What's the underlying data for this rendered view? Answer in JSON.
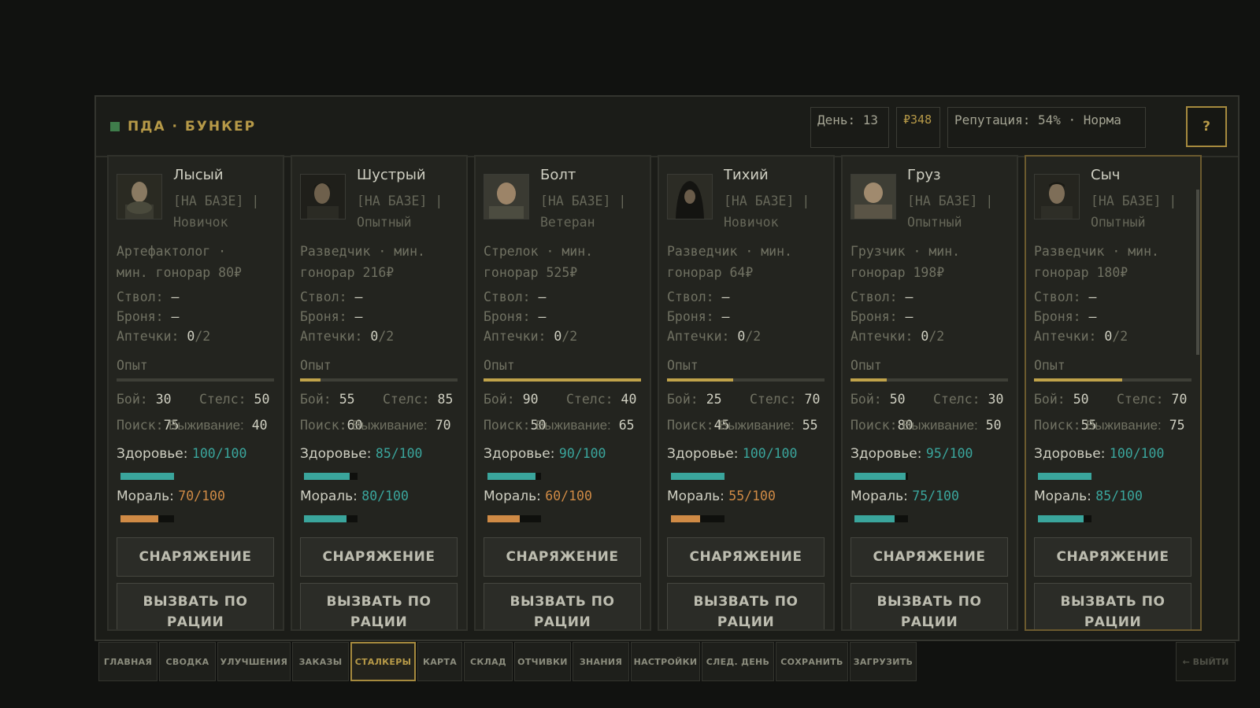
{
  "header": {
    "title": "ПДА · БУНКЕР",
    "day": "День: 13",
    "money": "₽348",
    "reputation": "Репутация: 54% · Норма",
    "help": "?"
  },
  "labels": {
    "barrel": "Ствол:",
    "armor": "Броня:",
    "medkits": "Аптечки:",
    "xp": "Опыт",
    "combat": "Бой:",
    "stealth": "Стелс:",
    "search": "Поиск:",
    "survival": "Выживание:",
    "health": "Здоровье:",
    "morale": "Мораль:",
    "equip_btn": "СНАРЯЖЕНИЕ",
    "radio_btn": "ВЫЗВАТЬ ПО РАЦИИ"
  },
  "colors": {
    "accent": "#b79a48",
    "health_bar": "#3aa59c",
    "morale_high": "#3aa59c",
    "morale_low": "#cf8a45"
  },
  "stalkers": [
    {
      "name": "Лысый",
      "status": "[НА БАЗЕ] |",
      "rank": "Новичок",
      "role1": "Артефактолог ·",
      "role2": "мин. гонорар 80₽",
      "barrel": "–",
      "armor": "–",
      "med_have": "0",
      "med_max": "/2",
      "xp": 0.0,
      "combat": "30",
      "stealth": "50",
      "search": "75",
      "survival": "40",
      "health": "100/100",
      "health_frac": 1.0,
      "morale": "70/100",
      "morale_frac": 0.7,
      "morale_color": "low",
      "highlight": false,
      "avatar": "bald-man"
    },
    {
      "name": "Шустрый",
      "status": "[НА БАЗЕ] |",
      "rank": "Опытный",
      "role1": "Разведчик · мин.",
      "role2": "гонорар 216₽",
      "barrel": "–",
      "armor": "–",
      "med_have": "0",
      "med_max": "/2",
      "xp": 0.13,
      "combat": "55",
      "stealth": "85",
      "search": "60",
      "survival": "70",
      "health": "85/100",
      "health_frac": 0.85,
      "morale": "80/100",
      "morale_frac": 0.8,
      "morale_color": "high",
      "highlight": false,
      "avatar": "dark-hair-man"
    },
    {
      "name": "Болт",
      "status": "[НА БАЗЕ] |",
      "rank": "Ветеран",
      "role1": "Стрелок · мин.",
      "role2": "гонорар 525₽",
      "barrel": "–",
      "armor": "–",
      "med_have": "0",
      "med_max": "/2",
      "xp": 1.0,
      "combat": "90",
      "stealth": "40",
      "search": "50",
      "survival": "65",
      "health": "90/100",
      "health_frac": 0.9,
      "morale": "60/100",
      "morale_frac": 0.6,
      "morale_color": "low",
      "highlight": false,
      "avatar": "veteran-man"
    },
    {
      "name": "Тихий",
      "status": "[НА БАЗЕ] |",
      "rank": "Новичок",
      "role1": "Разведчик · мин.",
      "role2": "гонорар 64₽",
      "barrel": "–",
      "armor": "–",
      "med_have": "0",
      "med_max": "/2",
      "xp": 0.42,
      "combat": "25",
      "stealth": "70",
      "search": "45",
      "survival": "55",
      "health": "100/100",
      "health_frac": 1.0,
      "morale": "55/100",
      "morale_frac": 0.55,
      "morale_color": "low",
      "highlight": false,
      "avatar": "hooded-figure"
    },
    {
      "name": "Груз",
      "status": "[НА БАЗЕ] |",
      "rank": "Опытный",
      "role1": "Грузчик · мин.",
      "role2": "гонорар 198₽",
      "barrel": "–",
      "armor": "–",
      "med_have": "0",
      "med_max": "/2",
      "xp": 0.23,
      "combat": "50",
      "stealth": "30",
      "search": "80",
      "survival": "50",
      "health": "95/100",
      "health_frac": 0.95,
      "morale": "75/100",
      "morale_frac": 0.75,
      "morale_color": "high",
      "highlight": false,
      "avatar": "heavy-man"
    },
    {
      "name": "Сыч",
      "status": "[НА БАЗЕ] |",
      "rank": "Опытный",
      "role1": "Разведчик · мин.",
      "role2": "гонорар 180₽",
      "barrel": "–",
      "armor": "–",
      "med_have": "0",
      "med_max": "/2",
      "xp": 0.56,
      "combat": "50",
      "stealth": "70",
      "search": "55",
      "survival": "75",
      "health": "100/100",
      "health_frac": 1.0,
      "morale": "85/100",
      "morale_frac": 0.85,
      "morale_color": "high",
      "highlight": true,
      "avatar": "short-hair-man"
    }
  ],
  "tabs": [
    {
      "label": "ГЛАВНАЯ",
      "active": false
    },
    {
      "label": "СВОДКА",
      "active": false
    },
    {
      "label": "УЛУЧШЕНИЯ",
      "active": false
    },
    {
      "label": "ЗАКАЗЫ",
      "active": false
    },
    {
      "label": "СТАЛКЕРЫ",
      "active": true
    },
    {
      "label": "КАРТА",
      "active": false
    },
    {
      "label": "СКЛАД",
      "active": false
    },
    {
      "label": "ОТЧИВКИ",
      "active": false
    },
    {
      "label": "ЗНАНИЯ",
      "active": false
    },
    {
      "label": "НАСТРОЙКИ",
      "active": false
    },
    {
      "label": "СЛЕД. ДЕНЬ",
      "active": false
    },
    {
      "label": "СОХРАНИТЬ",
      "active": false
    },
    {
      "label": "ЗАГРУЗИТЬ",
      "active": false
    }
  ],
  "exit_label": "← ВЫЙТИ"
}
